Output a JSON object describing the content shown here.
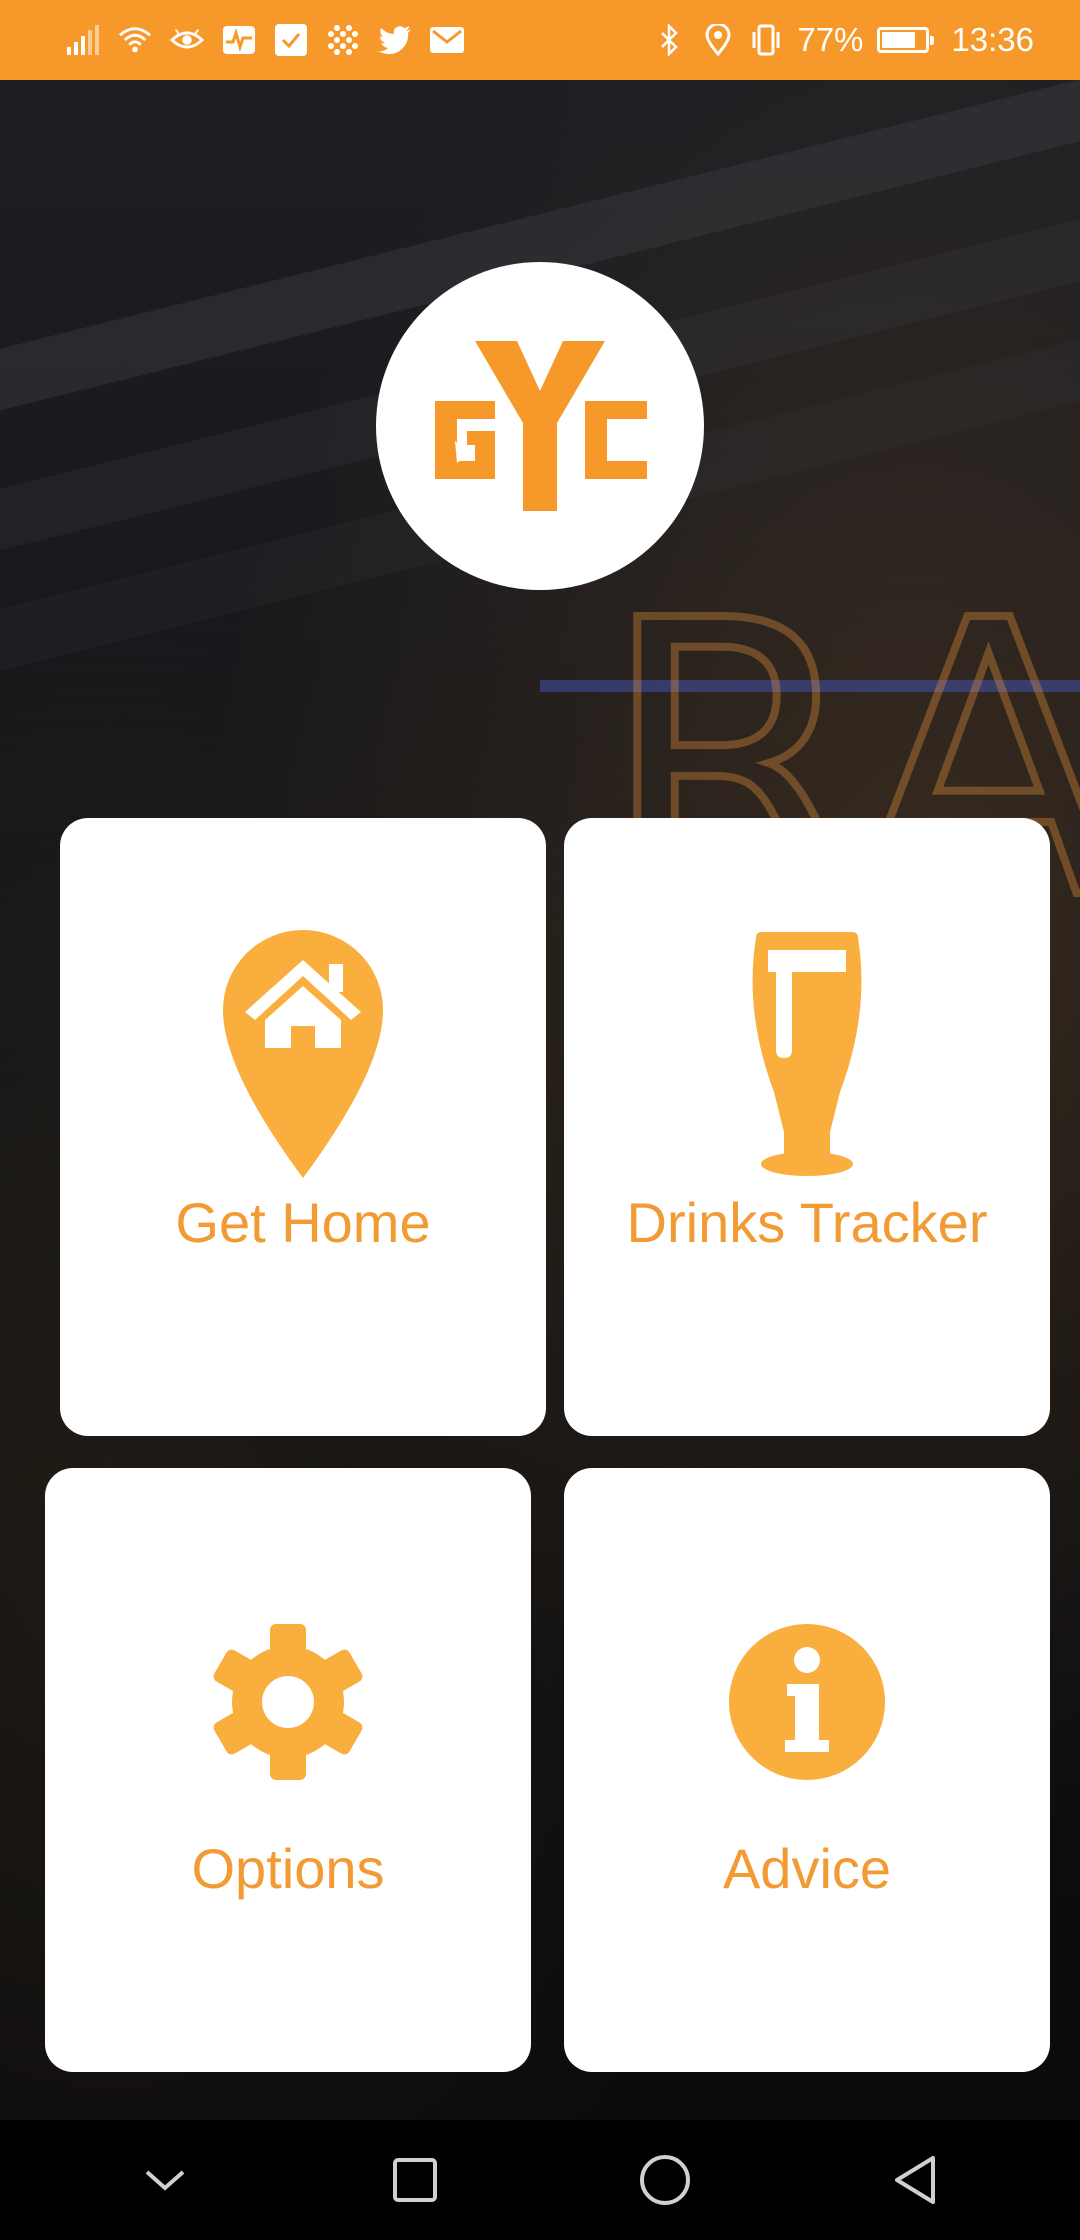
{
  "status_bar": {
    "battery_percent": "77%",
    "time": "13:36",
    "left_icons": [
      "signal-icon",
      "wifi-icon",
      "eye-icon",
      "activity-icon",
      "check-box-icon",
      "slack-icon",
      "twitter-icon",
      "mail-icon"
    ],
    "right_icons": [
      "bluetooth-icon",
      "location-icon",
      "vibrate-icon",
      "battery-icon"
    ]
  },
  "logo": {
    "text": "GYC"
  },
  "tiles": {
    "get_home": {
      "label": "Get Home",
      "icon": "home-pin-icon"
    },
    "drinks_tracker": {
      "label": "Drinks Tracker",
      "icon": "beer-glass-icon"
    },
    "options": {
      "label": "Options",
      "icon": "gear-icon"
    },
    "advice": {
      "label": "Advice",
      "icon": "info-icon"
    }
  },
  "nav_bar": {
    "buttons": [
      "chevron-down-icon",
      "recents-icon",
      "home-icon",
      "back-icon"
    ]
  },
  "colors": {
    "accent": "#f7992a",
    "tile_text": "#f29a33",
    "icon_fill": "#f9ae3d",
    "card_bg": "#ffffff"
  }
}
